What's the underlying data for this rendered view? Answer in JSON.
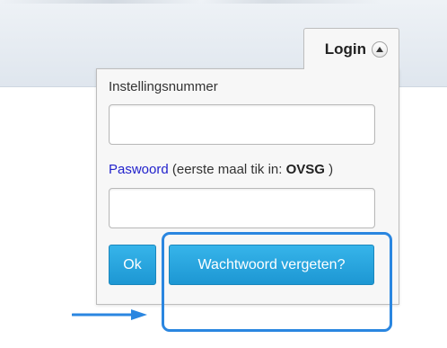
{
  "login": {
    "tab_label": "Login",
    "institution_label": "Instellingsnummer",
    "institution_value": "",
    "password_link": "Paswoord",
    "password_hint_prefix": "(eerste maal tik in: ",
    "password_hint_code": "OVSG",
    "password_hint_suffix": " )",
    "password_value": "",
    "ok_button": "Ok",
    "forgot_button": "Wachtwoord vergeten?"
  },
  "colors": {
    "button": "#1d97d3",
    "highlight": "#2a86e0",
    "link": "#2222cc"
  }
}
